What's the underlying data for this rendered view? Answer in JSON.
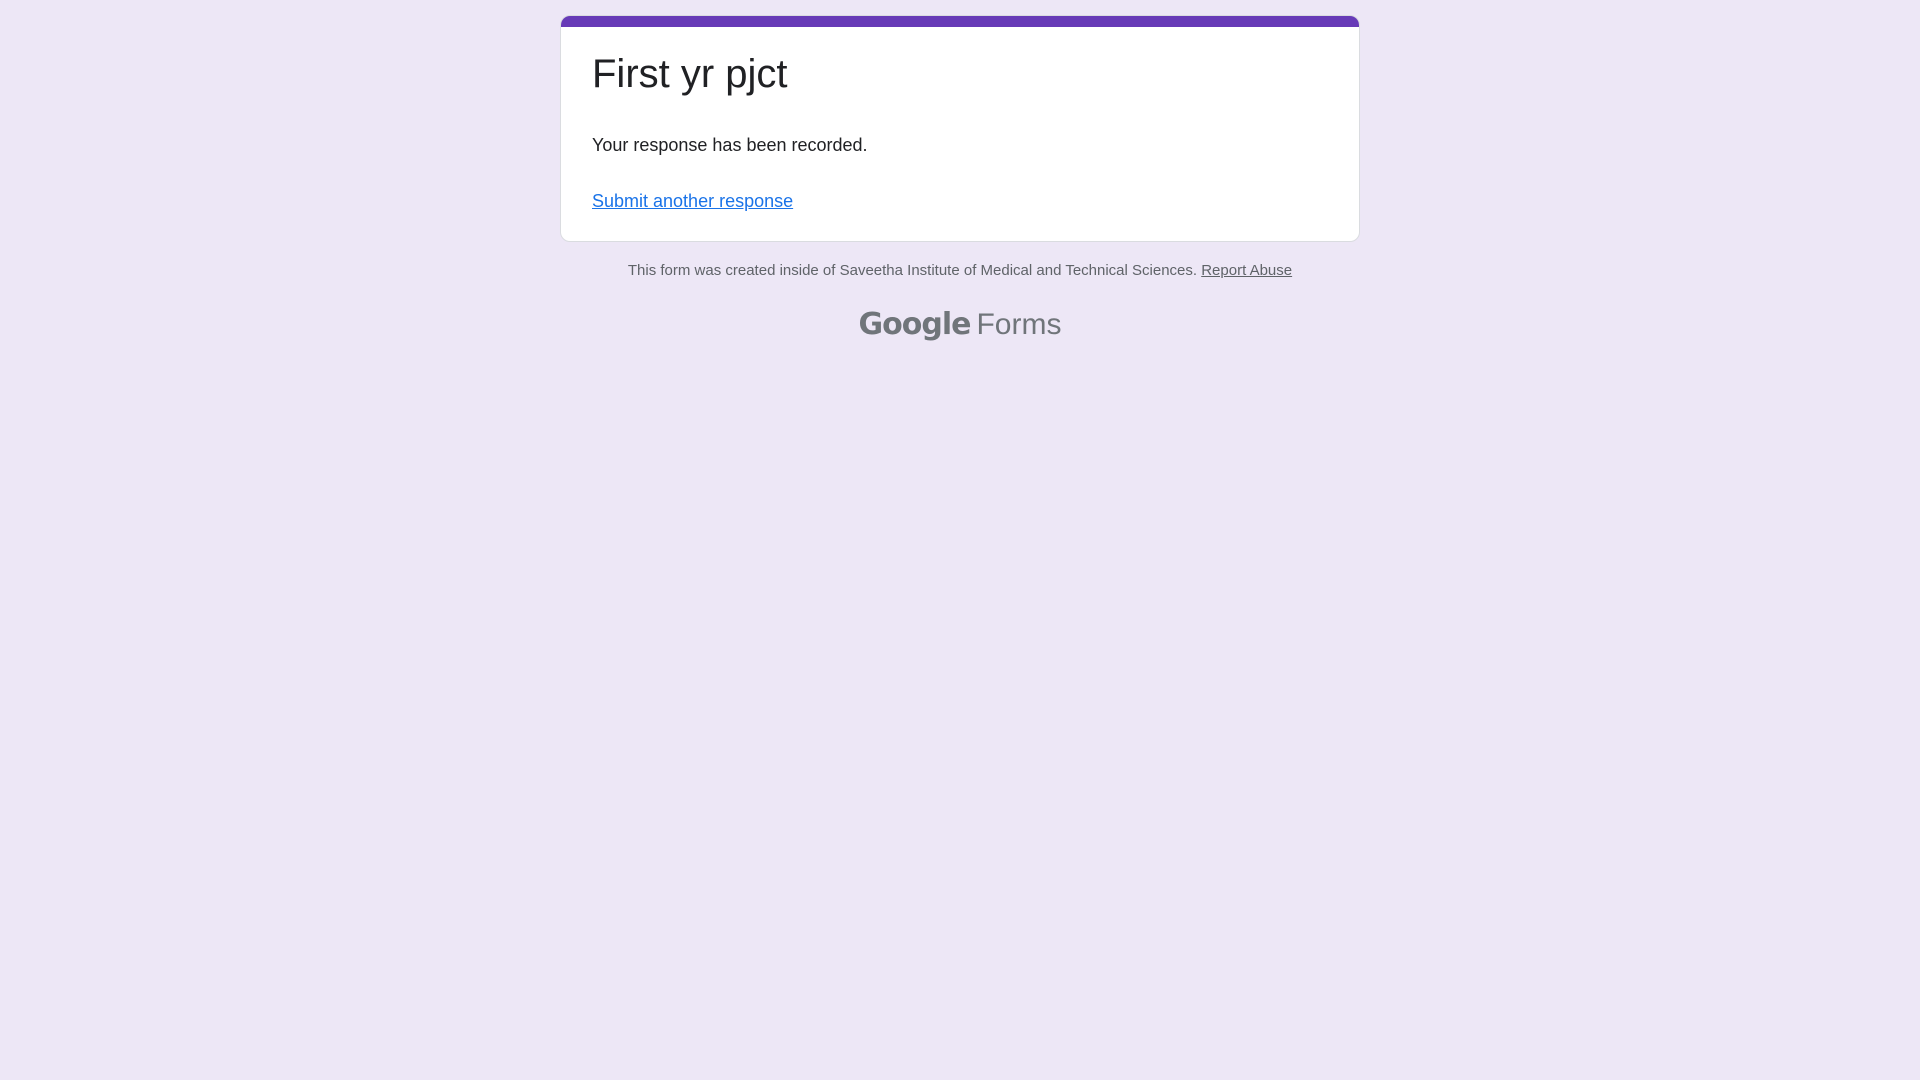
{
  "form": {
    "title": "First yr pjct",
    "message": "Your response has been recorded.",
    "submit_another_label": "Submit another response",
    "accent_color": "#673ab7",
    "background_color": "#ede7f6"
  },
  "footer": {
    "note": "This form was created inside of Saveetha Institute of Medical and Technical Sciences.",
    "report_abuse_label": "Report Abuse"
  },
  "brand": {
    "google": "Google",
    "forms": "Forms"
  }
}
